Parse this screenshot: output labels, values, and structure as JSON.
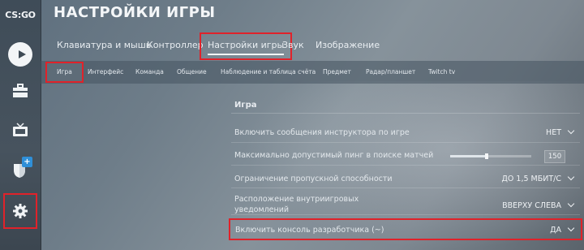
{
  "app": {
    "logo_text": "CS:GO",
    "page_title": "НАСТРОЙКИ ИГРЫ"
  },
  "sidebar": {
    "items": [
      {
        "name": "play",
        "icon": "play-icon"
      },
      {
        "name": "inventory",
        "icon": "briefcase-icon"
      },
      {
        "name": "watch",
        "icon": "tv-icon"
      },
      {
        "name": "news",
        "icon": "shield-icon",
        "badge": "+"
      },
      {
        "name": "settings",
        "icon": "gear-icon",
        "selected": true
      }
    ]
  },
  "top_tabs": [
    {
      "label": "Клавиатура и мышь"
    },
    {
      "label": "Контроллер"
    },
    {
      "label": "Настройки игры",
      "active": true
    },
    {
      "label": "Звук"
    },
    {
      "label": "Изображение"
    }
  ],
  "sub_tabs": [
    {
      "label": "Игра",
      "active": true
    },
    {
      "label": "Интерфейс"
    },
    {
      "label": "Команда"
    },
    {
      "label": "Общение"
    },
    {
      "label": "Наблюдение и таблица счёта"
    },
    {
      "label": "Предмет"
    },
    {
      "label": "Радар/планшет"
    },
    {
      "label": "Twitch tv"
    }
  ],
  "section": {
    "title": "Игра",
    "rows": [
      {
        "label": "Включить сообщения инструктора по игре",
        "value": "НЕТ",
        "type": "dropdown"
      },
      {
        "label": "Максимально допустимый пинг в поиске матчей",
        "value": "150",
        "type": "slider",
        "slider_fraction": 0.45
      },
      {
        "label": "Ограничение пропускной способности",
        "value": "ДО 1,5 МБИТ/С",
        "type": "dropdown"
      },
      {
        "label_line1": "Расположение внутриигровых",
        "label_line2": "уведомлений",
        "value": "ВВЕРХУ СЛЕВА",
        "type": "dropdown"
      },
      {
        "label": "Включить консоль разработчика (~)",
        "value": "ДА",
        "type": "dropdown",
        "highlighted": true
      }
    ]
  },
  "colors": {
    "highlight": "#e0222a",
    "badge": "#2f8fd8"
  }
}
